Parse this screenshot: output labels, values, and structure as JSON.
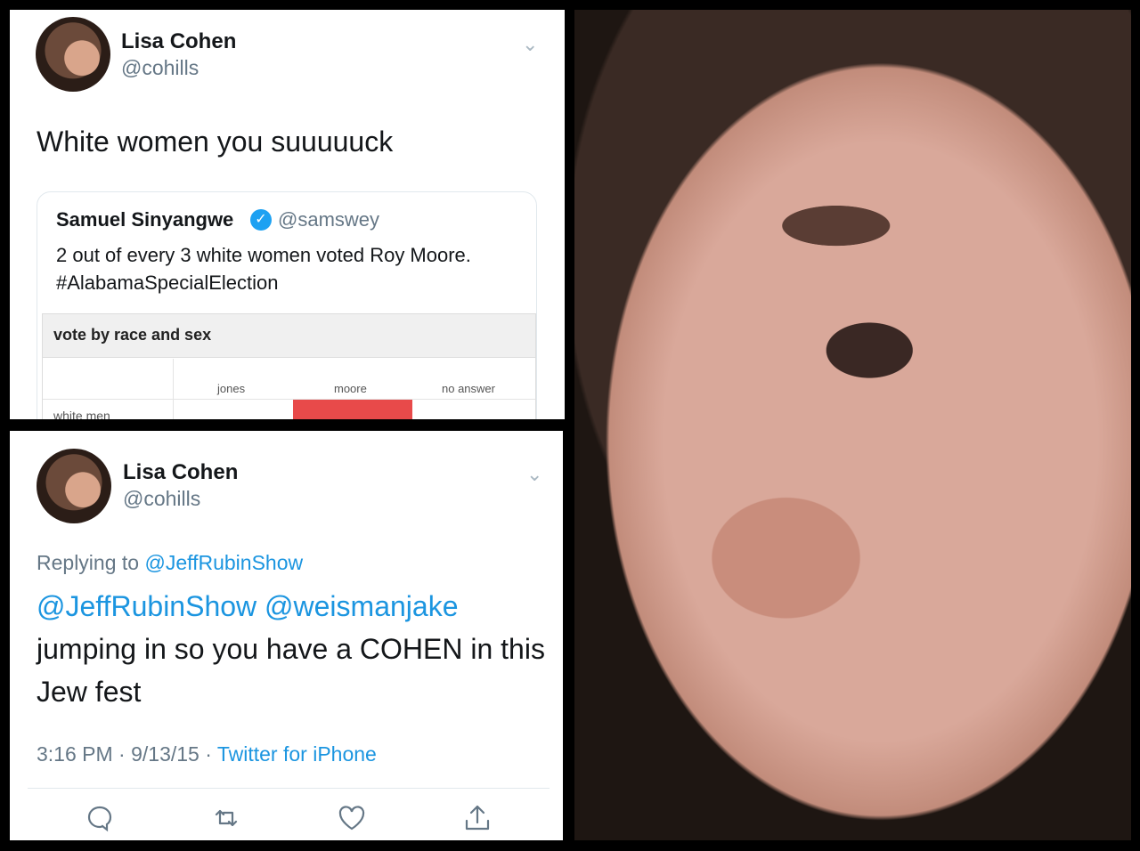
{
  "tweet1": {
    "author_name": "Lisa Cohen",
    "author_handle": "@cohills",
    "text": "White women you suuuuuck",
    "quoted": {
      "author_name": "Samuel Sinyangwe",
      "author_handle": "@samswey",
      "text_line1": "2 out of every 3 white women voted Roy Moore.",
      "text_line2": "#AlabamaSpecialElection",
      "table": {
        "title": "vote by race and sex",
        "columns": [
          "jones",
          "moore",
          "no answer"
        ],
        "row_label": "white men"
      }
    }
  },
  "tweet2": {
    "author_name": "Lisa Cohen",
    "author_handle": "@cohills",
    "replying_prefix": "Replying to ",
    "replying_to": "@JeffRubinShow",
    "mention1": "@JeffRubinShow",
    "mention2": "@weismanjake",
    "text_line1_rest": "",
    "text_line2": "jumping in so you have a COHEN in this",
    "text_line3": "Jew fest",
    "time": "3:16 PM · 9/13/15 · ",
    "source": "Twitter for iPhone",
    "actions": [
      "reply-icon",
      "retweet-icon",
      "like-icon",
      "share-icon"
    ]
  },
  "colors": {
    "link": "#1b95e0",
    "secondary_text": "#657786",
    "verified": "#1da1f2",
    "moore_bar": "#e84a4a"
  }
}
